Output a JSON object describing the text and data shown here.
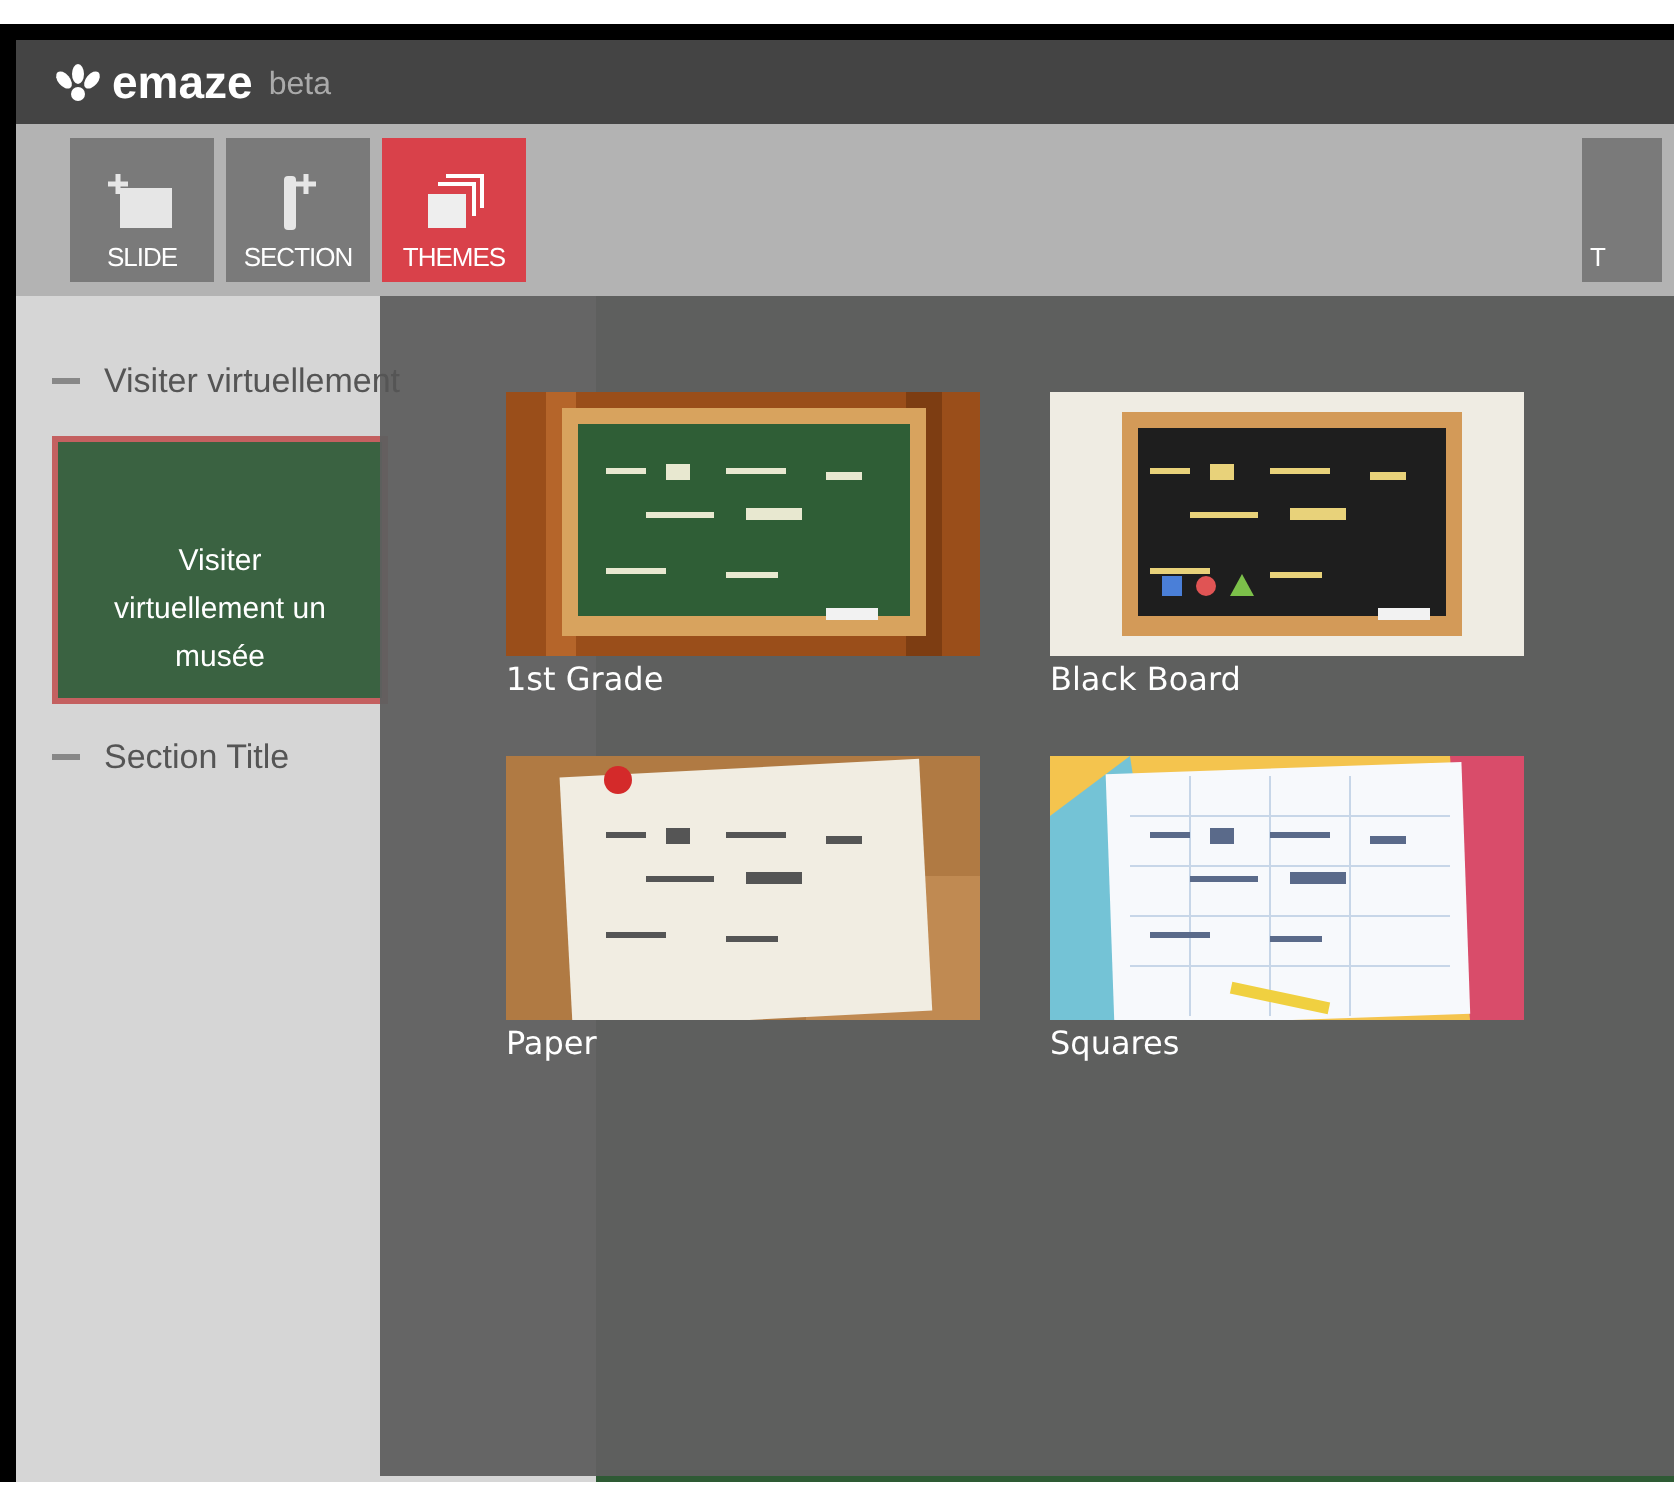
{
  "app": {
    "logo": "emaze",
    "badge": "beta"
  },
  "toolbar": [
    {
      "label": "SLIDE",
      "kind": "slide",
      "selected": false
    },
    {
      "label": "SECTION",
      "kind": "section",
      "selected": false
    },
    {
      "label": "THEMES",
      "kind": "themes",
      "selected": true
    }
  ],
  "toolbar_right": [
    {
      "label": "T"
    }
  ],
  "sidebar": {
    "sections": [
      {
        "title": "Visiter virtuellement",
        "expanded": true,
        "slides": [
          {
            "text": "Visiter virtuellement un musée",
            "selected": true
          }
        ]
      },
      {
        "title": "Section Title",
        "expanded": true
      }
    ]
  },
  "themes": [
    {
      "name": "1st Grade",
      "kind": "greenboard"
    },
    {
      "name": "Black Board",
      "kind": "blackboard"
    },
    {
      "name": "Paper",
      "kind": "paper"
    },
    {
      "name": "Squares",
      "kind": "squares"
    }
  ]
}
